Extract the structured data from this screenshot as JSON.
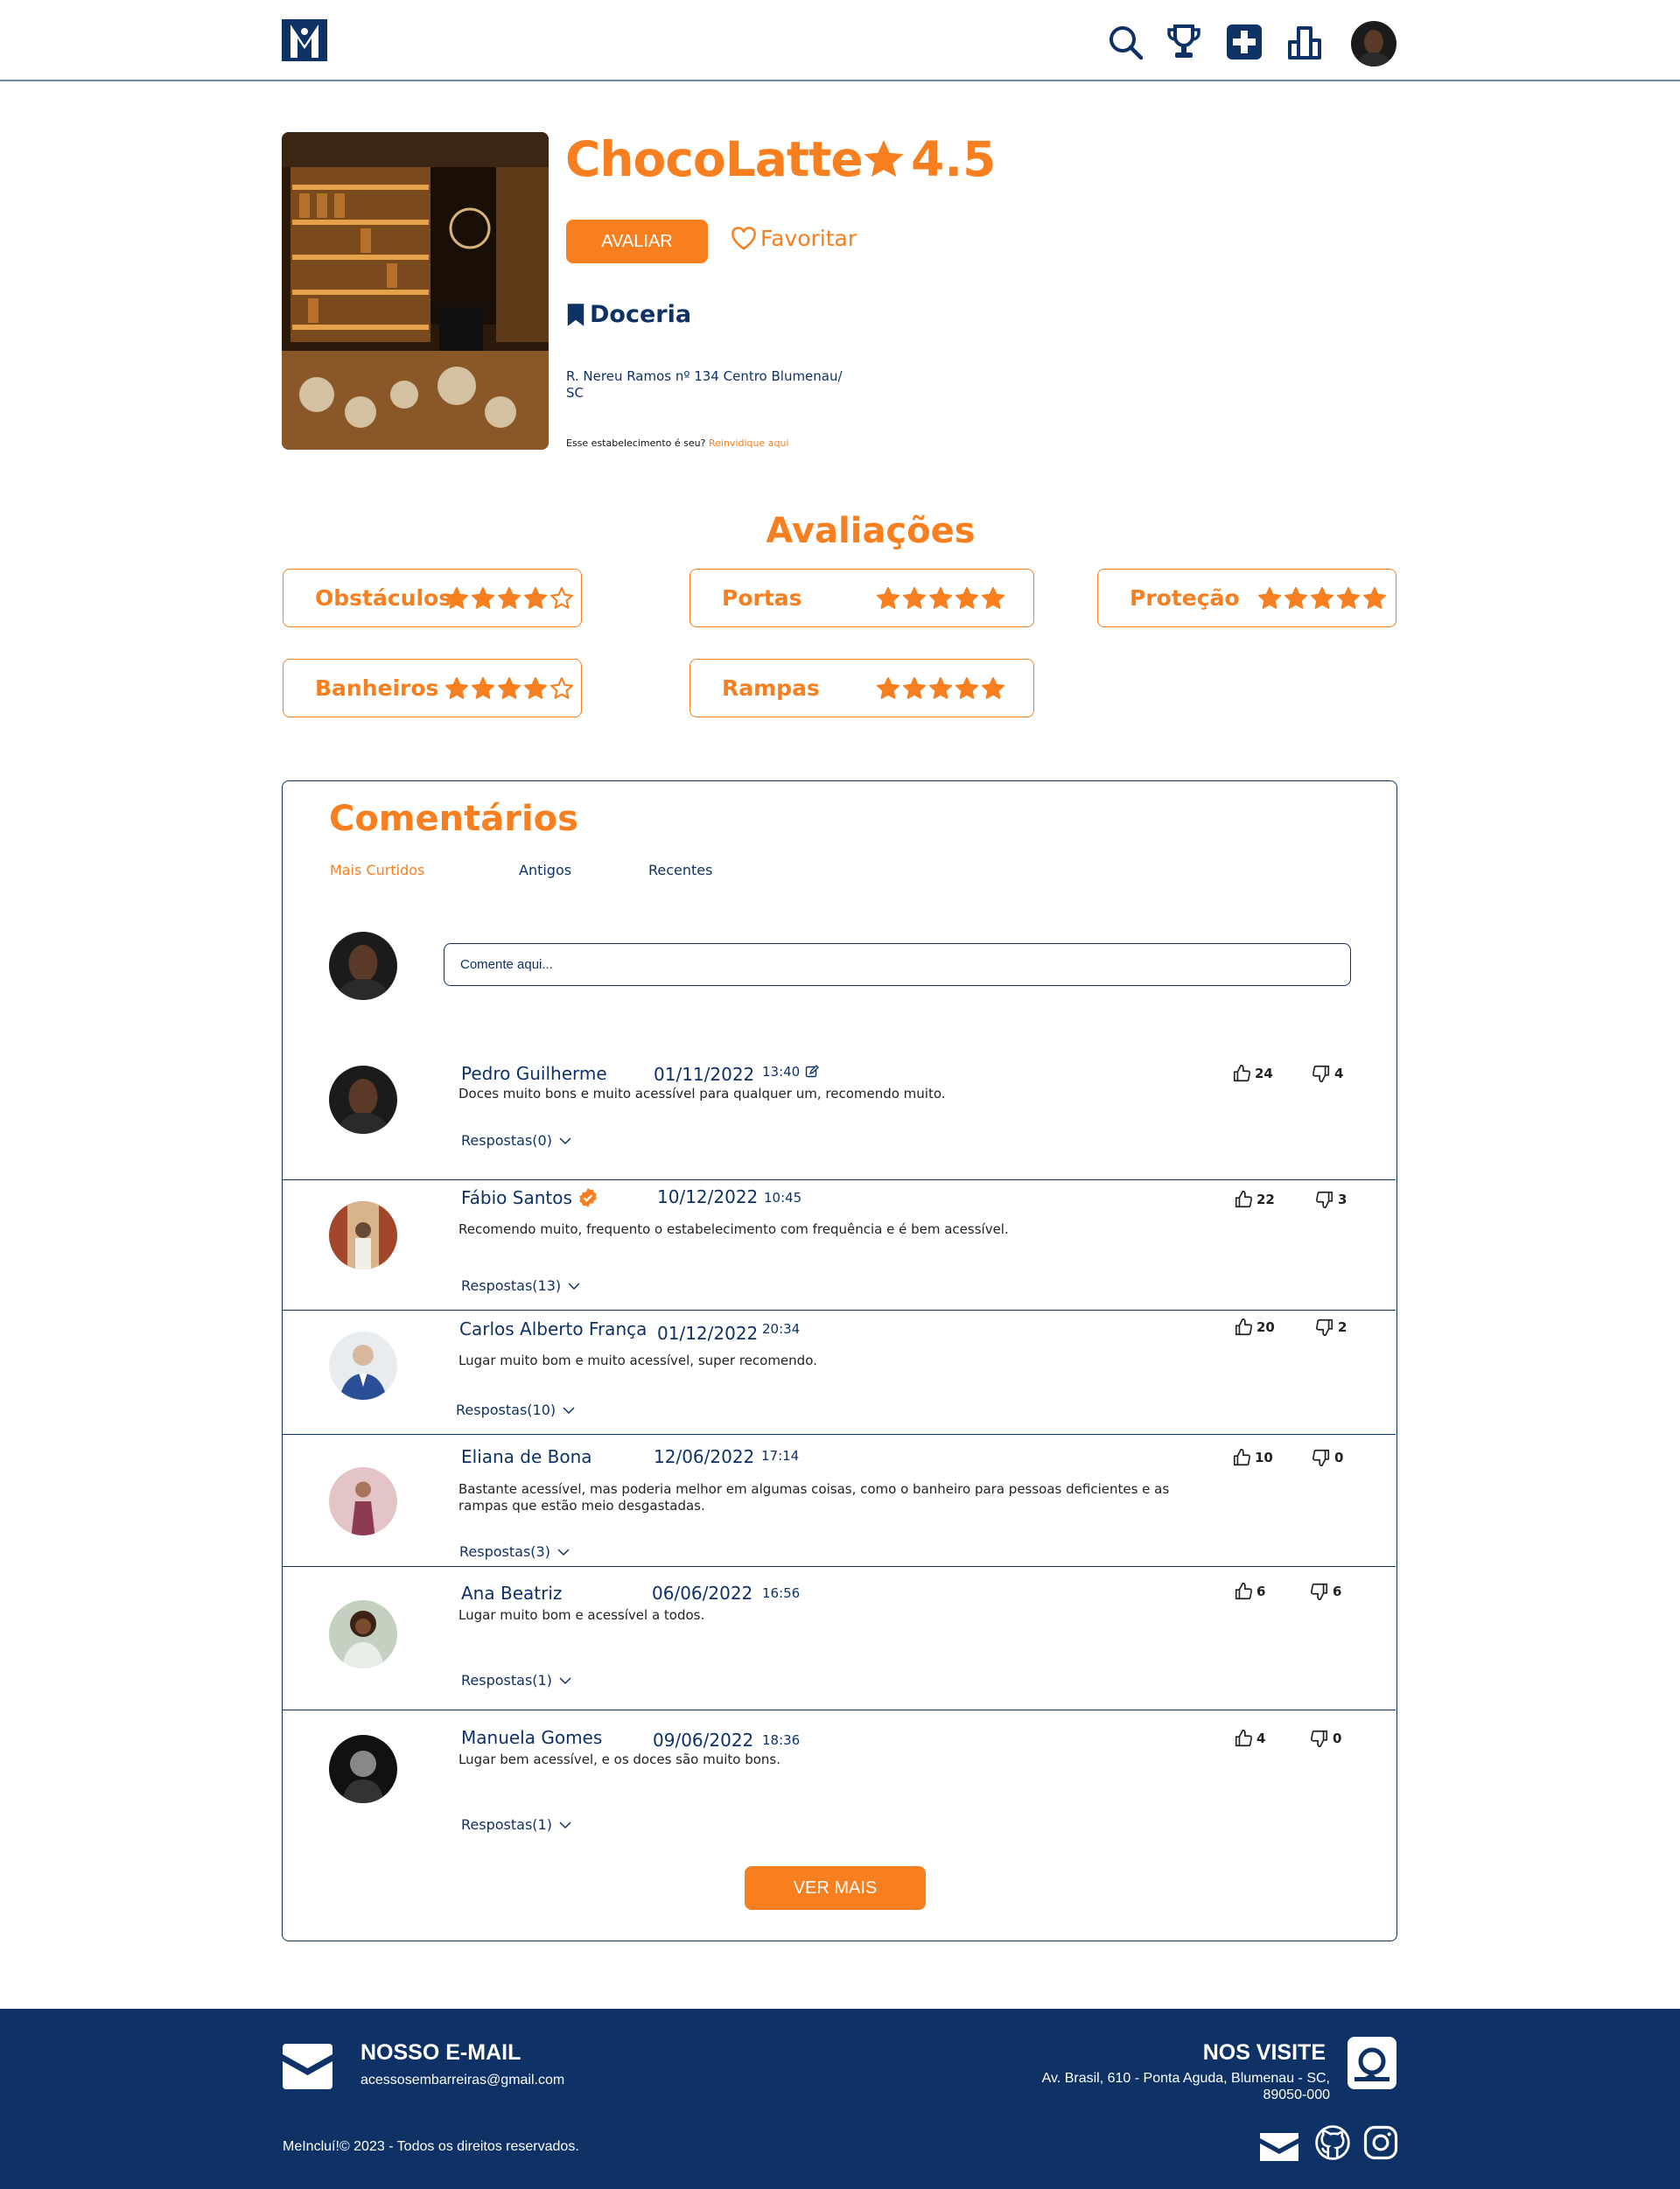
{
  "nav": {
    "icons": [
      "search-icon",
      "trophy-icon",
      "add-icon",
      "ranking-icon"
    ]
  },
  "place": {
    "name": "ChocoLatte",
    "rating": "4.5",
    "rate_button": "AVALIAR",
    "favorite": "Favoritar",
    "category": "Doceria",
    "address": "R. Nereu Ramos nº 134 Centro Blumenau/ SC",
    "claim_text": "Esse estabelecimento é seu?",
    "claim_link": "Reinvidique aqui"
  },
  "ratings": {
    "title": "Avaliações",
    "items": [
      {
        "label": "Obstáculos",
        "stars": 4
      },
      {
        "label": "Portas",
        "stars": 5
      },
      {
        "label": "Proteção",
        "stars": 5
      },
      {
        "label": "Banheiros",
        "stars": 4
      },
      {
        "label": "Rampas",
        "stars": 5
      }
    ]
  },
  "comments": {
    "title": "Comentários",
    "tabs": [
      "Mais Curtidos",
      "Antigos",
      "Recentes"
    ],
    "active_tab": "Mais Curtidos",
    "input_placeholder": "Comente aqui...",
    "see_more": "VER MAIS",
    "list": [
      {
        "name": "Pedro Guilherme",
        "verified": false,
        "editable": true,
        "date": "01/11/2022",
        "time": "13:40",
        "text": "Doces muito bons e muito acessível para qualquer um, recomendo muito.",
        "replies": "Respostas(0)",
        "likes": "24",
        "dislikes": "4"
      },
      {
        "name": "Fábio Santos",
        "verified": true,
        "editable": false,
        "date": "10/12/2022",
        "time": "10:45",
        "text": "Recomendo muito, frequento o estabelecimento com frequência e é bem acessível.",
        "replies": "Respostas(13)",
        "likes": "22",
        "dislikes": "3"
      },
      {
        "name": "Carlos Alberto França",
        "verified": false,
        "editable": false,
        "date": "01/12/2022",
        "time": "20:34",
        "text": "Lugar muito bom e muito acessível, super recomendo.",
        "replies": "Respostas(10)",
        "likes": "20",
        "dislikes": "2"
      },
      {
        "name": "Eliana de Bona",
        "verified": false,
        "editable": false,
        "date": "12/06/2022",
        "time": "17:14",
        "text": "Bastante acessível, mas poderia melhor em algumas coisas, como o banheiro para pessoas deficientes e as rampas que estão meio desgastadas.",
        "replies": "Respostas(3)",
        "likes": "10",
        "dislikes": "0"
      },
      {
        "name": "Ana Beatriz",
        "verified": false,
        "editable": false,
        "date": "06/06/2022",
        "time": "16:56",
        "text": "Lugar muito bom e acessível a todos.",
        "replies": "Respostas(1)",
        "likes": "6",
        "dislikes": "6"
      },
      {
        "name": "Manuela Gomes",
        "verified": false,
        "editable": false,
        "date": "09/06/2022",
        "time": "18:36",
        "text": "Lugar bem acessível, e os doces são muito bons.",
        "replies": "Respostas(1)",
        "likes": "4",
        "dislikes": "0"
      }
    ]
  },
  "footer": {
    "email_title": "NOSSO E-MAIL",
    "email": "acessosembarreiras@gmail.com",
    "visit_title": "NOS VISITE",
    "visit_address": "Av. Brasil, 610 - Ponta Aguda, Blumenau - SC, 89050-000",
    "copyright": "MeIncluí!© 2023 - Todos os direitos reservados.",
    "social_icons": [
      "mail-icon",
      "github-icon",
      "instagram-icon"
    ]
  },
  "colors": {
    "primary": "#0e3266",
    "accent": "#f77f1f"
  }
}
